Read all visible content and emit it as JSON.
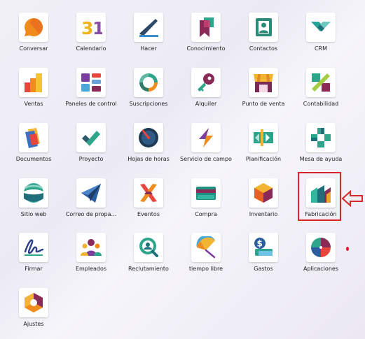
{
  "apps": [
    {
      "label": "Conversar",
      "icon": "chat-bubble-icon"
    },
    {
      "label": "Calendario",
      "icon": "calendar-icon"
    },
    {
      "label": "Hacer",
      "icon": "pen-checkmark-icon"
    },
    {
      "label": "Conocimiento",
      "icon": "bookmark-icon"
    },
    {
      "label": "Contactos",
      "icon": "contact-card-icon"
    },
    {
      "label": "CRM",
      "icon": "handshake-icon"
    },
    {
      "label": "Ventas",
      "icon": "bar-chart-icon"
    },
    {
      "label": "Paneles de control",
      "icon": "dashboard-tiles-icon"
    },
    {
      "label": "Suscripciones",
      "icon": "recurring-circle-icon"
    },
    {
      "label": "Alquiler",
      "icon": "key-icon"
    },
    {
      "label": "Punto de venta",
      "icon": "shop-awning-icon"
    },
    {
      "label": "Contabilidad",
      "icon": "percent-icon"
    },
    {
      "label": "Documentos",
      "icon": "documents-icon"
    },
    {
      "label": "Proyecto",
      "icon": "checkmark-icon"
    },
    {
      "label": "Hojas de horas",
      "icon": "timer-icon"
    },
    {
      "label": "Servicio de campo",
      "icon": "lightning-icon"
    },
    {
      "label": "Planificación",
      "icon": "planning-icon"
    },
    {
      "label": "Mesa de ayuda",
      "icon": "helpdesk-icon"
    },
    {
      "label": "Sitio web",
      "icon": "globe-icon"
    },
    {
      "label": "Correo de propa...",
      "icon": "paper-plane-icon"
    },
    {
      "label": "Eventos",
      "icon": "crossed-ribbon-icon"
    },
    {
      "label": "Compra",
      "icon": "credit-card-icon"
    },
    {
      "label": "Inventario",
      "icon": "box-icon"
    },
    {
      "label": "Fabricación",
      "icon": "factory-icon"
    },
    {
      "label": "Firmar",
      "icon": "signature-icon"
    },
    {
      "label": "Empleados",
      "icon": "people-icon"
    },
    {
      "label": "Reclutamiento",
      "icon": "magnifier-person-icon"
    },
    {
      "label": "tiempo libre",
      "icon": "umbrella-icon"
    },
    {
      "label": "Gastos",
      "icon": "money-icon"
    },
    {
      "label": "Aplicaciones",
      "icon": "pie-apps-icon"
    },
    {
      "label": "Ajustes",
      "icon": "settings-hexagon-icon"
    }
  ],
  "annotation": {
    "highlighted_app": "Fabricación",
    "box_color": "#d9252a",
    "arrow_color": "#d9252a",
    "dot_color": "#e8122f"
  }
}
